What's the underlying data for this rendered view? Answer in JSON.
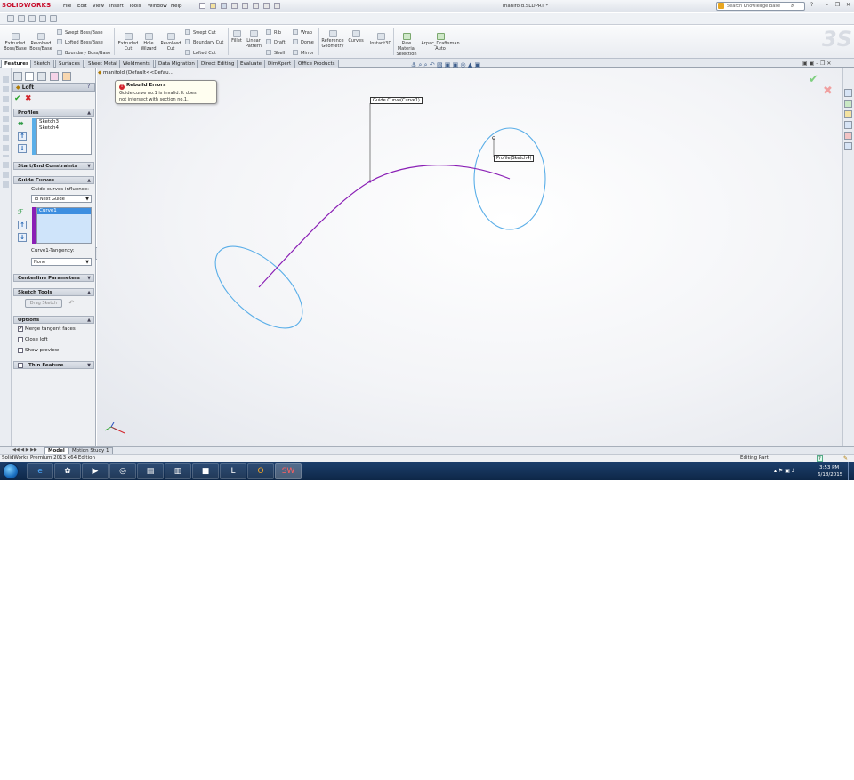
{
  "app": {
    "logo_text": "SOLIDWORKS",
    "doc_title": "manifold.SLDPRT *",
    "menus": [
      "File",
      "Edit",
      "View",
      "Insert",
      "Tools",
      "Window",
      "Help"
    ],
    "search_placeholder": "Search Knowledge Base"
  },
  "command_manager": {
    "buttons": [
      {
        "label1": "Extruded",
        "label2": "Boss/Base"
      },
      {
        "label1": "Revolved",
        "label2": "Boss/Base"
      },
      {
        "label1": "Extruded",
        "label2": "Cut"
      },
      {
        "label1": "Hole",
        "label2": "Wizard"
      },
      {
        "label1": "Revolved",
        "label2": "Cut"
      },
      {
        "label1": "Fillet",
        "label2": ""
      },
      {
        "label1": "Linear",
        "label2": "Pattern"
      },
      {
        "label1": "Reference",
        "label2": "Geometry"
      },
      {
        "label1": "Curves",
        "label2": ""
      },
      {
        "label1": "Instant3D",
        "label2": ""
      },
      {
        "label1": "Raw",
        "label2": "Material",
        "label3": "Selection"
      },
      {
        "label1": "Arpac_Draftsman",
        "label2": "Auto"
      }
    ],
    "small": {
      "swept_boss": "Swept Boss/Base",
      "lofted_boss": "Lofted Boss/Base",
      "boundary_boss": "Boundary Boss/Base",
      "swept_cut": "Swept Cut",
      "boundary_cut": "Boundary Cut",
      "lofted_cut": "Lofted Cut",
      "rib": "Rib",
      "draft": "Draft",
      "shell": "Shell",
      "wrap": "Wrap",
      "dome": "Dome",
      "mirror": "Mirror"
    }
  },
  "tabs": [
    "Features",
    "Sketch",
    "Surfaces",
    "Sheet Metal",
    "Weldments",
    "Data Migration",
    "Direct Editing",
    "Evaluate",
    "DimXpert",
    "Office Products"
  ],
  "active_tab": "Features",
  "property_manager": {
    "title": "Loft",
    "help": "?",
    "profiles_header": "Profiles",
    "profiles": [
      "Sketch3",
      "Sketch4"
    ],
    "start_end_header": "Start/End Constraints",
    "guide_header": "Guide Curves",
    "guide_influence_label": "Guide curves influence:",
    "guide_influence_value": "To Next Guide",
    "guide_curves": [
      "Curve1"
    ],
    "tangency_label": "Curve1-Tangency:",
    "tangency_value": "None",
    "centerline_header": "Centerline Parameters",
    "sketch_tools_header": "Sketch Tools",
    "drag_sketch": "Drag Sketch",
    "options_header": "Options",
    "options": [
      {
        "label": "Merge tangent faces",
        "checked": true
      },
      {
        "label": "Close loft",
        "checked": false
      },
      {
        "label": "Show preview",
        "checked": false
      }
    ],
    "thin_feature_header": "Thin Feature"
  },
  "graphics": {
    "tree_flyout": "manifold (Default<<Defau...",
    "error_title": "Rebuild Errors",
    "error_msg1": "Guide curve no.1 is invalid. It does",
    "error_msg2": "not intersect with section no.1.",
    "callout_guide": "Guide Curve(Curve1)",
    "callout_profile": "Profile(Sketch4)",
    "colors": {
      "sketch_profile": "#5aaee8",
      "guide_curve": "#8a1fb5"
    }
  },
  "bottom_tabs": [
    "Model",
    "Motion Study 1"
  ],
  "status": {
    "left": "SolidWorks Premium 2013 x64 Edition",
    "right": "Editing Part"
  },
  "taskbar": {
    "time": "3:53 PM",
    "date": "6/18/2015"
  }
}
